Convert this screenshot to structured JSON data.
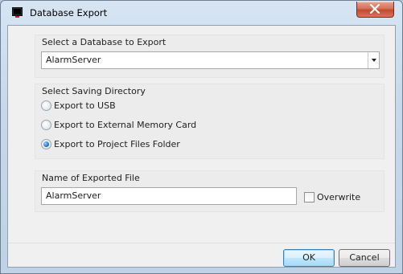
{
  "window": {
    "title": "Database Export",
    "close_glyph": "✕"
  },
  "database_group": {
    "label": "Select a Database to Export",
    "selected_value": "AlarmServer"
  },
  "directory_group": {
    "label": "Select Saving Directory",
    "options": [
      {
        "label": "Export to USB",
        "checked": false
      },
      {
        "label": "Export to External Memory Card",
        "checked": false
      },
      {
        "label": "Export to Project Files Folder",
        "checked": true
      }
    ]
  },
  "file_group": {
    "label": "Name of Exported File",
    "file_name": "AlarmServer",
    "overwrite_label": "Overwrite",
    "overwrite_checked": false
  },
  "buttons": {
    "ok": "OK",
    "cancel": "Cancel"
  },
  "colors": {
    "accent": "#2b74c8",
    "close_red": "#c24a2f"
  },
  "icons": {
    "app": "terminal-window-icon",
    "close": "close-icon",
    "dropdown": "chevron-down-icon"
  }
}
